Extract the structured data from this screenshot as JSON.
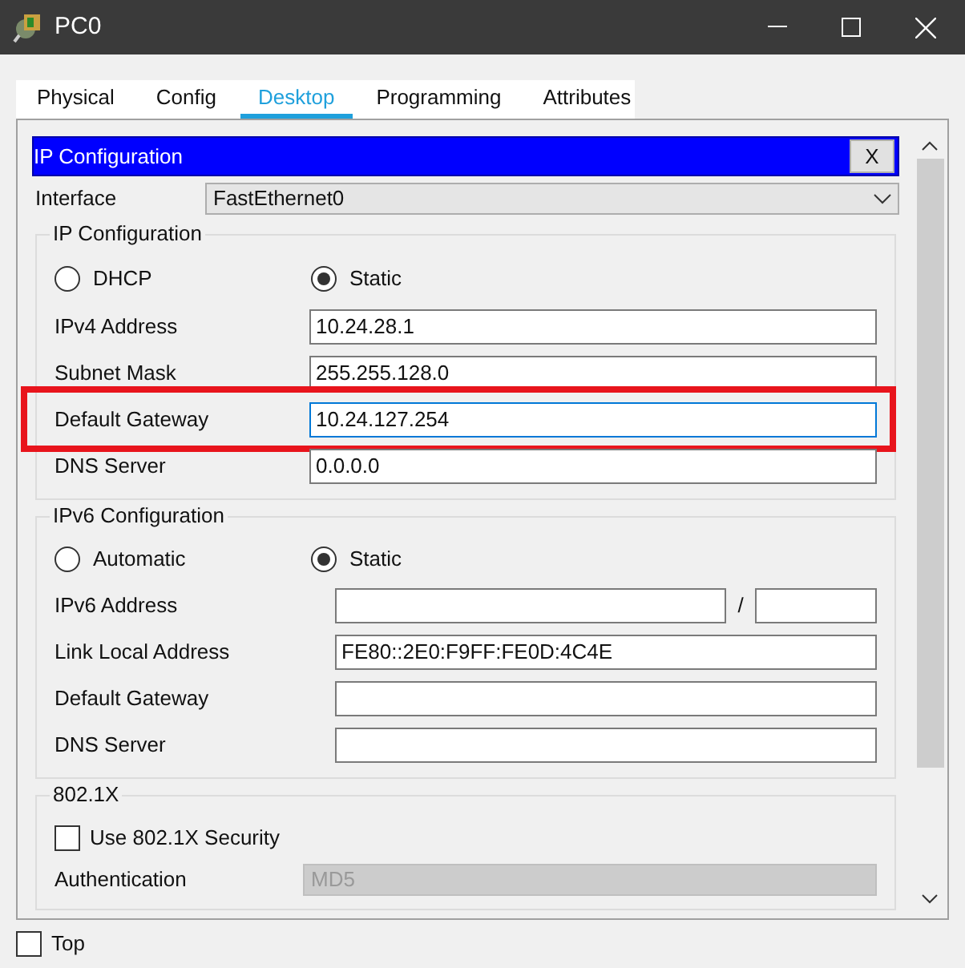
{
  "window": {
    "title": "PC0"
  },
  "tabs": [
    {
      "label": "Physical",
      "selected": false
    },
    {
      "label": "Config",
      "selected": false
    },
    {
      "label": "Desktop",
      "selected": true
    },
    {
      "label": "Programming",
      "selected": false
    },
    {
      "label": "Attributes",
      "selected": false
    }
  ],
  "panel": {
    "title": "IP Configuration",
    "close_label": "X",
    "interface_label": "Interface",
    "interface_value": "FastEthernet0"
  },
  "ipv4": {
    "title": "IP Configuration",
    "modes": [
      {
        "label": "DHCP",
        "selected": false
      },
      {
        "label": "Static",
        "selected": true
      }
    ],
    "fields": [
      {
        "label": "IPv4 Address",
        "value": "10.24.28.1",
        "focused": false,
        "highlighted": false
      },
      {
        "label": "Subnet Mask",
        "value": "255.255.128.0",
        "focused": false,
        "highlighted": false
      },
      {
        "label": "Default Gateway",
        "value": "10.24.127.254",
        "focused": true,
        "highlighted": true
      },
      {
        "label": "DNS Server",
        "value": "0.0.0.0",
        "focused": false,
        "highlighted": false
      }
    ]
  },
  "ipv6": {
    "title": "IPv6 Configuration",
    "modes": [
      {
        "label": "Automatic",
        "selected": false
      },
      {
        "label": "Static",
        "selected": true
      }
    ],
    "fields": [
      {
        "kind": "prefix",
        "label": "IPv6 Address",
        "separator": "/"
      },
      {
        "kind": "text",
        "label": "Link Local Address",
        "value": "FE80::2E0:F9FF:FE0D:4C4E"
      },
      {
        "kind": "text",
        "label": "Default Gateway"
      },
      {
        "kind": "text",
        "label": "DNS Server"
      }
    ]
  },
  "dot1x": {
    "title": "802.1X",
    "security": {
      "label": "Use 802.1X Security",
      "checked": false
    },
    "auth": {
      "label": "Authentication",
      "value": "MD5",
      "disabled": true
    }
  },
  "footer": {
    "top": {
      "label": "Top",
      "checked": false
    }
  }
}
